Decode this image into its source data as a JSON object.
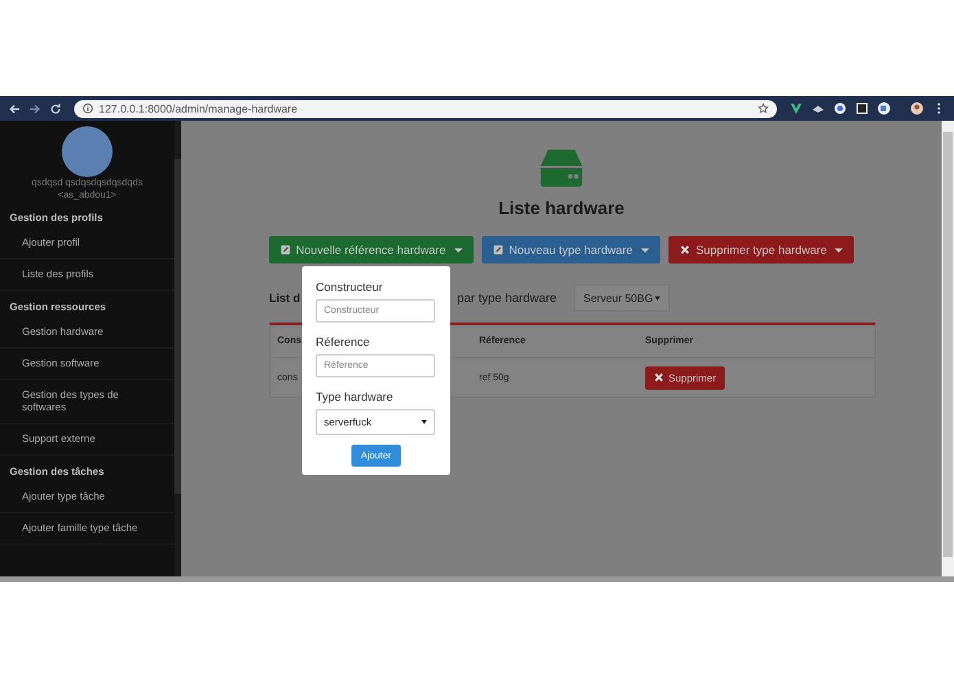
{
  "browser": {
    "url": "127.0.0.1:8000/admin/manage-hardware"
  },
  "sidebar": {
    "user": {
      "name": "qsdqsd qsdqsdqsdqsdqds",
      "handle": "<as_abdou1>"
    },
    "sections": [
      {
        "title": "Gestion des profils",
        "items": [
          {
            "label": "Ajouter profil"
          },
          {
            "label": "Liste des profils"
          }
        ]
      },
      {
        "title": "Gestion ressources",
        "items": [
          {
            "label": "Gestion hardware"
          },
          {
            "label": "Gestion software"
          },
          {
            "label": "Gestion des types de softwares"
          },
          {
            "label": "Support externe"
          }
        ]
      },
      {
        "title": "Gestion des tâches",
        "items": [
          {
            "label": "Ajouter type tâche"
          },
          {
            "label": "Ajouter famille type tâche"
          }
        ]
      }
    ]
  },
  "main": {
    "title": "Liste hardware",
    "buttons": [
      {
        "label": "Nouvelle référence hardware",
        "kind": "success"
      },
      {
        "label": "Nouveau type hardware",
        "kind": "primary"
      },
      {
        "label": "Supprimer type hardware",
        "kind": "danger"
      }
    ],
    "filter": {
      "text_start": "List d",
      "text_end": "par type hardware",
      "select_value": "Serveur 50BG"
    },
    "table": {
      "columns": [
        "Cons",
        "Réference",
        "Supprimer"
      ],
      "rows": [
        {
          "cells": [
            {
              "kind": "text",
              "text": "cons"
            },
            {
              "kind": "text",
              "text": "ref 50g"
            },
            {
              "kind": "button",
              "text": "Supprimer"
            }
          ]
        }
      ]
    }
  },
  "popup": {
    "fields": [
      {
        "kind": "input",
        "label": "Constructeur",
        "placeholder": "Constructeur"
      },
      {
        "kind": "input",
        "label": "Réference",
        "placeholder": "Réference"
      },
      {
        "kind": "select",
        "label": "Type hardware",
        "value": "serverfuck"
      }
    ],
    "button": "Ajouter"
  }
}
